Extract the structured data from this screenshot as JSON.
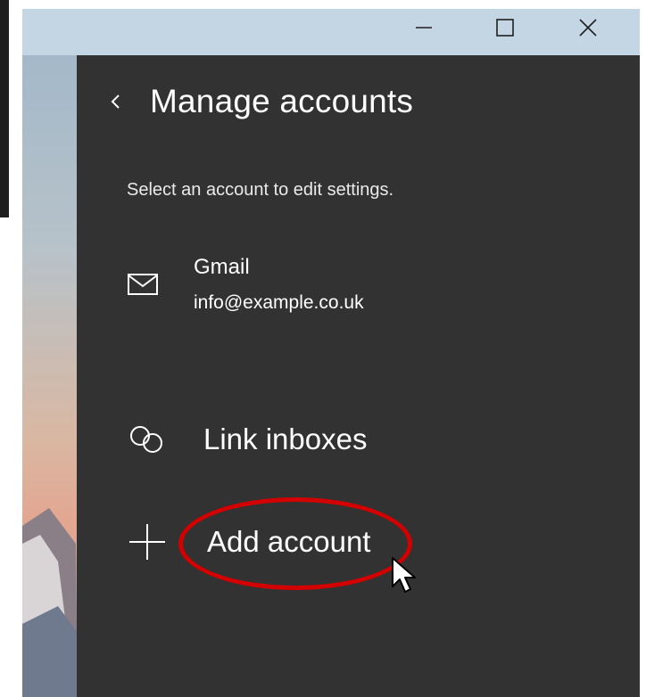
{
  "window": {
    "controls": {
      "minimize_icon": "minimize-icon",
      "maximize_icon": "maximize-icon",
      "close_icon": "close-icon"
    }
  },
  "pane": {
    "back_icon": "chevron-left-icon",
    "title": "Manage accounts",
    "subtitle": "Select an account to edit settings.",
    "account": {
      "icon": "mail-icon",
      "name": "Gmail",
      "email": "info@example.co.uk"
    },
    "link_inboxes": {
      "icon": "link-icon",
      "label": "Link inboxes"
    },
    "add_account": {
      "icon": "plus-icon",
      "label": "Add account"
    }
  },
  "colors": {
    "pane_background": "#323232",
    "titlebar": "#c4d6e4",
    "highlight": "#d40000",
    "text": "#ffffff"
  }
}
